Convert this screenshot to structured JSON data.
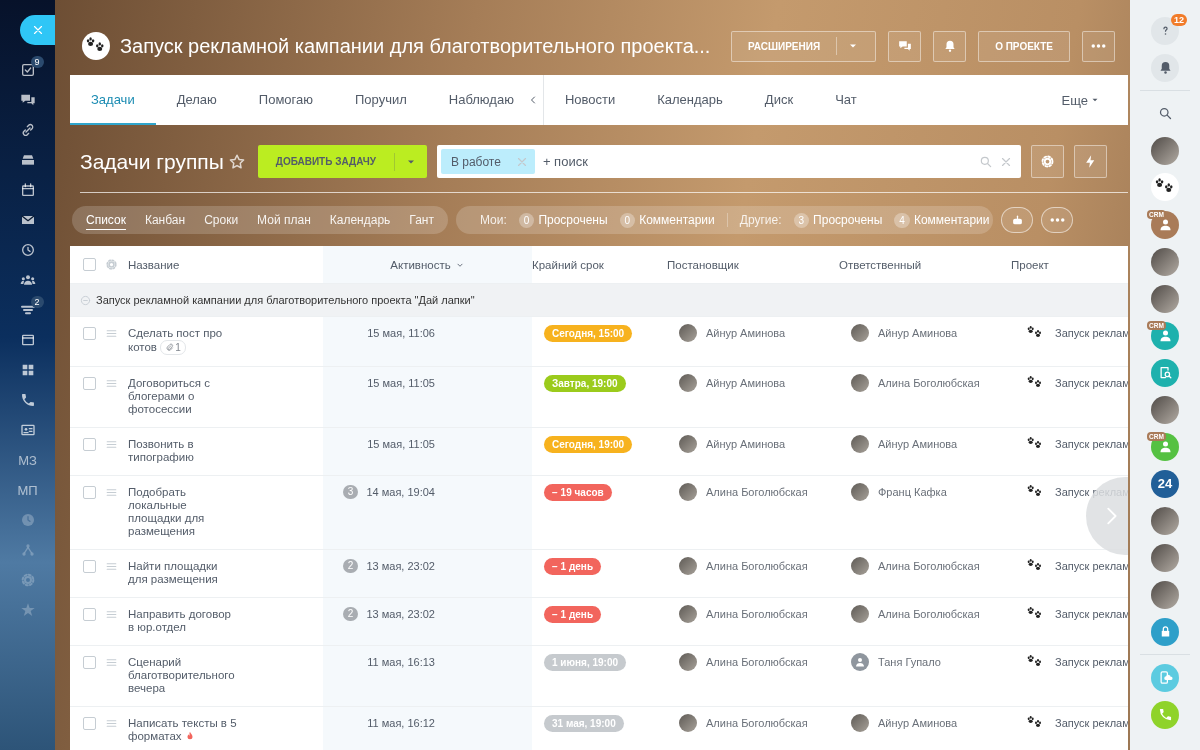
{
  "left_menu": [
    {
      "kind": "close",
      "dimmed": false
    },
    {
      "kind": "icon",
      "badge": "9",
      "dimmed": false
    },
    {
      "kind": "icon",
      "dimmed": false
    },
    {
      "kind": "icon",
      "dimmed": false
    },
    {
      "kind": "icon",
      "dimmed": false
    },
    {
      "kind": "icon",
      "dimmed": false
    },
    {
      "kind": "icon",
      "dimmed": false
    },
    {
      "kind": "icon",
      "dimmed": false
    },
    {
      "kind": "icon",
      "dimmed": false
    },
    {
      "kind": "icon",
      "badge": "2",
      "dimmed": false
    },
    {
      "kind": "icon",
      "dimmed": false
    },
    {
      "kind": "icon",
      "dimmed": false
    },
    {
      "kind": "icon",
      "dimmed": false
    },
    {
      "kind": "icon",
      "dimmed": false
    },
    {
      "kind": "text",
      "label": "МЗ",
      "dimmed": false
    },
    {
      "kind": "text",
      "label": "МП",
      "dimmed": false
    },
    {
      "kind": "icon",
      "dimmed": true
    },
    {
      "kind": "icon",
      "dimmed": true
    },
    {
      "kind": "icon",
      "dimmed": true
    },
    {
      "kind": "icon",
      "dimmed": true
    }
  ],
  "header": {
    "title": "Запуск рекламной кампании для благотворительного проекта...",
    "buttons": [
      {
        "kind": "dropdown",
        "label": "РАСШИРЕНИЯ"
      },
      {
        "kind": "chat"
      },
      {
        "kind": "bell"
      },
      {
        "kind": "text",
        "label": "О ПРОЕКТЕ"
      },
      {
        "kind": "more"
      }
    ]
  },
  "tabs": {
    "task_tabs": [
      {
        "label": "Задачи",
        "selected": true
      },
      {
        "label": "Делаю",
        "selected": false
      },
      {
        "label": "Помогаю",
        "selected": false
      },
      {
        "label": "Поручил",
        "selected": false
      },
      {
        "label": "Наблюдаю",
        "selected": false
      }
    ],
    "project_tabs": [
      {
        "label": "Новости",
        "selected": false
      },
      {
        "label": "Календарь",
        "selected": false
      },
      {
        "label": "Диск",
        "selected": false
      },
      {
        "label": "Чат",
        "selected": false
      }
    ],
    "more": "Еще"
  },
  "toolbar": {
    "title": "Задачи группы",
    "add_button": "ДОБАВИТЬ ЗАДАЧУ",
    "filter_tag": "В работе",
    "placeholder": "+ поиск"
  },
  "filter_bar": {
    "views": [
      {
        "label": "Список",
        "selected": true
      },
      {
        "label": "Канбан",
        "selected": false
      },
      {
        "label": "Сроки",
        "selected": false
      },
      {
        "label": "Мой план",
        "selected": false
      },
      {
        "label": "Календарь",
        "selected": false
      },
      {
        "label": "Гант",
        "selected": false
      }
    ],
    "counter_groups": [
      {
        "label": "Мои:",
        "items": [
          {
            "count": "0",
            "label": "Просрочены"
          },
          {
            "count": "0",
            "label": "Комментарии"
          }
        ]
      },
      {
        "label": "Другие:",
        "items": [
          {
            "count": "3",
            "label": "Просрочены"
          },
          {
            "count": "4",
            "label": "Комментарии"
          }
        ]
      }
    ]
  },
  "table": {
    "all_checked": false,
    "columns": [
      {
        "label": "Название",
        "sorted": false
      },
      {
        "label": "Активность",
        "sorted": true
      },
      {
        "label": "Крайний срок",
        "sorted": false
      },
      {
        "label": "Постановщик",
        "sorted": false
      },
      {
        "label": "Ответственный",
        "sorted": false
      },
      {
        "label": "Проект",
        "sorted": false
      }
    ],
    "group": {
      "title": "Запуск рекламной кампании для благотворительного проекта \"Дай лапки\"",
      "expanded": true
    },
    "rows": [
      {
        "checked": false,
        "title": "Сделать пост про котов",
        "attachments": "1",
        "hot": false,
        "activity": "15 мая, 11:06",
        "deadline": {
          "text": "Сегодня, 15:00",
          "color": "#f7b21e"
        },
        "creator": {
          "name": "Айнур Аминова",
          "kind": "photo"
        },
        "responsible": {
          "name": "Айнур Аминова",
          "kind": "photo"
        },
        "project": "Запуск реклам"
      },
      {
        "checked": false,
        "title": "Договориться с блогерами о фотосессии",
        "hot": false,
        "activity": "15 мая, 11:05",
        "deadline": {
          "text": "Завтра, 19:00",
          "color": "#9bcb1c"
        },
        "creator": {
          "name": "Айнур Аминова",
          "kind": "photo"
        },
        "responsible": {
          "name": "Алина Боголюбская",
          "kind": "photo"
        },
        "project": "Запуск реклам"
      },
      {
        "checked": false,
        "title": "Позвонить в типографию",
        "hot": false,
        "activity": "15 мая, 11:05",
        "deadline": {
          "text": "Сегодня, 19:00",
          "color": "#f7b21e"
        },
        "creator": {
          "name": "Айнур Аминова",
          "kind": "photo"
        },
        "responsible": {
          "name": "Айнур Аминова",
          "kind": "photo"
        },
        "project": "Запуск реклам"
      },
      {
        "checked": false,
        "title": "Подобрать локальные площадки для размещения",
        "hot": false,
        "comments": "3",
        "activity": "14 мая, 19:04",
        "deadline": {
          "text": "− 19 часов",
          "color": "#f2655d"
        },
        "creator": {
          "name": "Алина Боголюбская",
          "kind": "photo"
        },
        "responsible": {
          "name": "Франц Кафка",
          "kind": "photo"
        },
        "project": "Запуск реклам"
      },
      {
        "checked": false,
        "title": "Найти площадки для размещения",
        "hot": false,
        "comments": "2",
        "activity": "13 мая, 23:02",
        "deadline": {
          "text": "− 1 день",
          "color": "#f2655d"
        },
        "creator": {
          "name": "Алина Боголюбская",
          "kind": "photo"
        },
        "responsible": {
          "name": "Алина Боголюбская",
          "kind": "photo"
        },
        "project": "Запуск реклам"
      },
      {
        "checked": false,
        "title": "Направить договор в юр.отдел",
        "hot": false,
        "comments": "2",
        "activity": "13 мая, 23:02",
        "deadline": {
          "text": "− 1 день",
          "color": "#f2655d"
        },
        "creator": {
          "name": "Алина Боголюбская",
          "kind": "photo"
        },
        "responsible": {
          "name": "Алина Боголюбская",
          "kind": "photo"
        },
        "project": "Запуск реклам"
      },
      {
        "checked": false,
        "title": "Сценарий благотворительного вечера",
        "hot": false,
        "activity": "11 мая, 16:13",
        "deadline": {
          "text": "1 июня, 19:00",
          "color": "#c6cace"
        },
        "creator": {
          "name": "Алина Боголюбская",
          "kind": "photo"
        },
        "responsible": {
          "name": "Таня Гупало",
          "kind": "default"
        },
        "project": "Запуск реклам"
      },
      {
        "checked": false,
        "title": "Написать тексты в 5 форматах",
        "hot": true,
        "activity": "11 мая, 16:12",
        "deadline": {
          "text": "31 мая, 19:00",
          "color": "#c6cace"
        },
        "creator": {
          "name": "Алина Боголюбская",
          "kind": "photo"
        },
        "responsible": {
          "name": "Айнур Аминова",
          "kind": "photo"
        },
        "project": "Запуск реклам"
      }
    ]
  },
  "right_panel": {
    "items": [
      {
        "kind": "help",
        "badge": "12"
      },
      {
        "kind": "bell"
      },
      {
        "kind": "search"
      },
      {
        "kind": "avatar"
      },
      {
        "kind": "project"
      },
      {
        "kind": "contact",
        "badge": "CRM",
        "color": "#a97b58"
      },
      {
        "kind": "avatar"
      },
      {
        "kind": "avatar"
      },
      {
        "kind": "contact",
        "badge": "CRM",
        "color": "#1eb1ad"
      },
      {
        "kind": "openline",
        "color": "#1eb1ad"
      },
      {
        "kind": "avatar"
      },
      {
        "kind": "contact",
        "badge": "CRM",
        "color": "#55c142"
      },
      {
        "kind": "logo",
        "label": "24",
        "color": "#215f98"
      },
      {
        "kind": "avatar"
      },
      {
        "kind": "avatar"
      },
      {
        "kind": "avatar"
      },
      {
        "kind": "lock",
        "color": "#2e9fc9"
      },
      {
        "kind": "cloud",
        "color": "#5ccbe0"
      },
      {
        "kind": "phone",
        "color": "#8fd32a"
      }
    ]
  }
}
